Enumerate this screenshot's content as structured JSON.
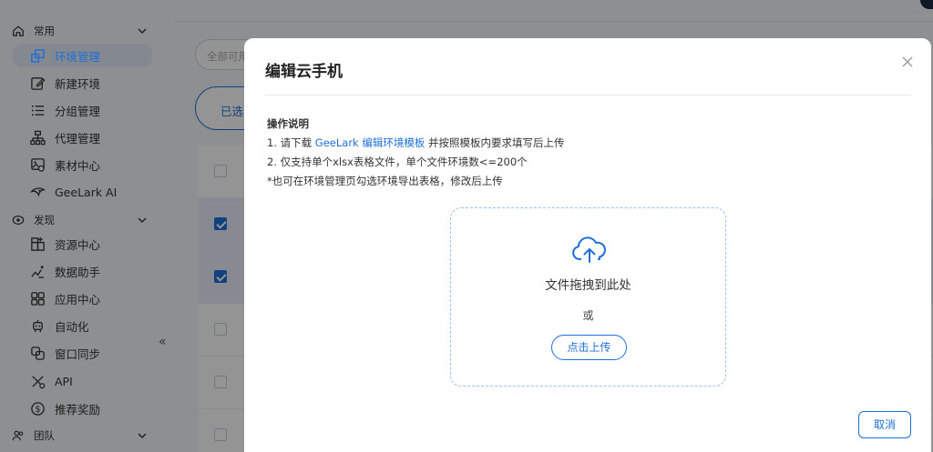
{
  "sidebar": {
    "groups": [
      {
        "label": "常用",
        "icon": "home-icon"
      },
      {
        "label": "发现",
        "icon": "compass-icon"
      },
      {
        "label": "团队",
        "icon": "team-icon"
      }
    ],
    "items": [
      {
        "label": "环境管理",
        "icon": "environment-icon",
        "active": true
      },
      {
        "label": "新建环境",
        "icon": "edit-icon"
      },
      {
        "label": "分组管理",
        "icon": "list-icon"
      },
      {
        "label": "代理管理",
        "icon": "proxy-icon"
      },
      {
        "label": "素材中心",
        "icon": "material-icon"
      },
      {
        "label": "GeeLark AI",
        "icon": "ai-icon"
      },
      {
        "label": "资源中心",
        "icon": "resource-icon"
      },
      {
        "label": "数据助手",
        "icon": "data-icon"
      },
      {
        "label": "应用中心",
        "icon": "apps-icon"
      },
      {
        "label": "自动化",
        "icon": "robot-icon"
      },
      {
        "label": "窗口同步",
        "icon": "sync-icon"
      },
      {
        "label": "API",
        "icon": "api-icon"
      },
      {
        "label": "推荐奖励",
        "icon": "dollar-icon"
      }
    ],
    "collapse_label": "«"
  },
  "background": {
    "search_placeholder": "全部可用",
    "selected_label": "已选"
  },
  "modal": {
    "title": "编辑云手机",
    "instructions": {
      "heading": "操作说明",
      "line1_prefix": "1. 请下载 ",
      "line1_link": "GeeLark 编辑环境模板",
      "line1_suffix": " 并按照模板内要求填写后上传",
      "line2": "2. 仅支持单个xlsx表格文件，单个文件环境数<=200个",
      "line3": "*也可在环境管理页勾选环境导出表格，修改后上传"
    },
    "dropzone": {
      "drag_text": "文件拖拽到此处",
      "or_text": "或",
      "upload_label": "点击上传"
    },
    "cancel_label": "取消"
  },
  "colors": {
    "accent": "#1e6fd9",
    "overlay": "rgba(0,0,0,0.42)"
  }
}
